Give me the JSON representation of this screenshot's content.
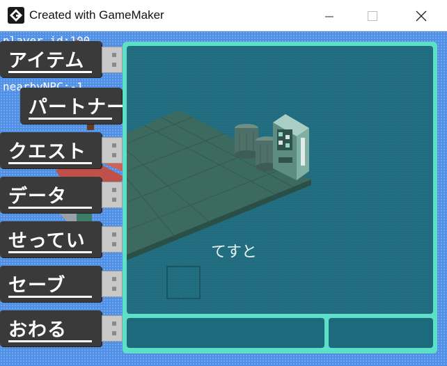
{
  "window": {
    "title": "Created with GameMaker"
  },
  "debug": {
    "line1": "player_id:100",
    "line2": "nearbyNPC:-1"
  },
  "menu": {
    "items": [
      {
        "label": "アイテム"
      },
      {
        "label": "パートナー"
      },
      {
        "label": "クエスト"
      },
      {
        "label": "データ"
      },
      {
        "label": "せってい"
      },
      {
        "label": "セーブ"
      },
      {
        "label": "おわる"
      }
    ]
  },
  "dialog": {
    "text": "てすと"
  },
  "colors": {
    "panel_border": "#5ee0c8",
    "panel_fill": "#1c6a7c",
    "menu_bg": "#3a3a3a",
    "background": "#4f8fe6"
  }
}
